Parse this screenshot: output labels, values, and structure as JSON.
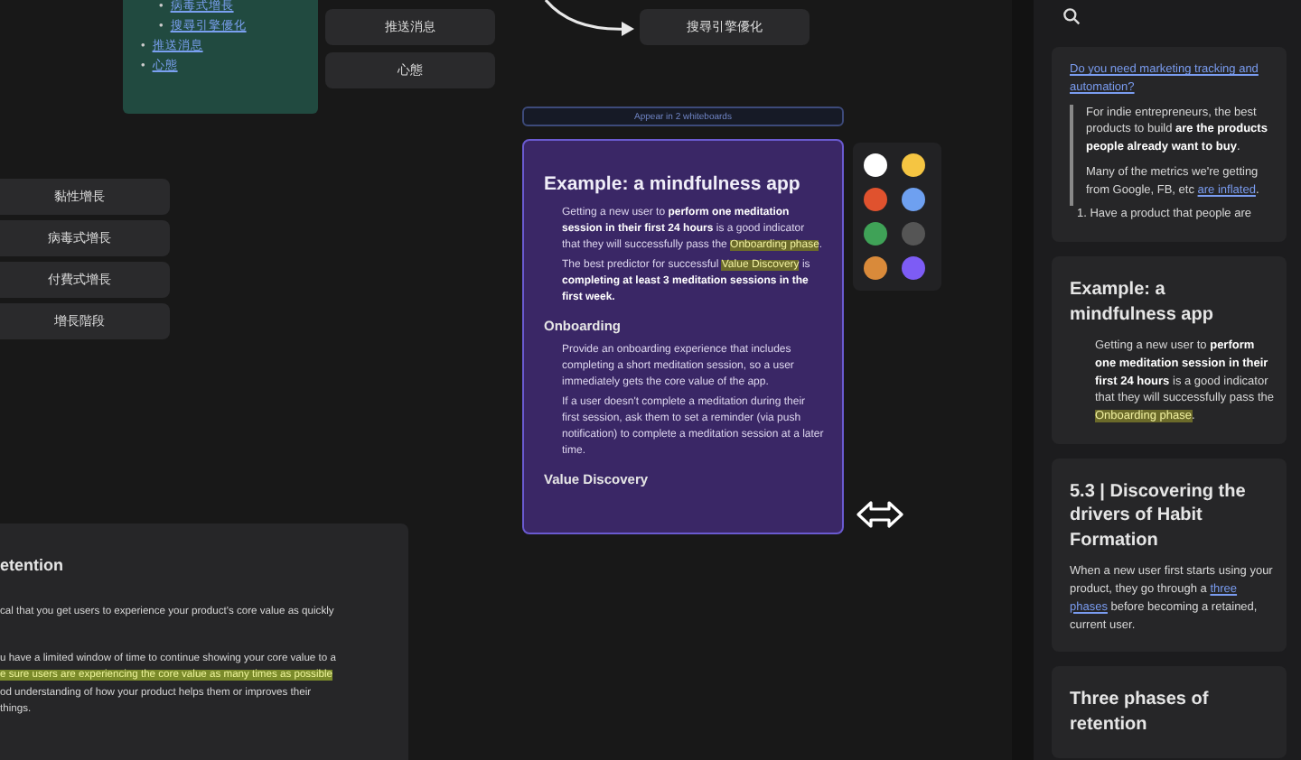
{
  "outline_card": {
    "items": [
      {
        "marker": "•",
        "text": "病毒式增長"
      },
      {
        "marker": "•",
        "text": "搜尋引擎優化"
      }
    ],
    "top_items": [
      {
        "marker": "•",
        "text": "推送消息"
      },
      {
        "marker": "•",
        "text": "心態"
      }
    ]
  },
  "topic_cards": [
    {
      "text": "推送消息"
    },
    {
      "text": "心態"
    }
  ],
  "linked_card": {
    "text": "搜尋引擎優化"
  },
  "left_cards": [
    {
      "text": "黏性增長"
    },
    {
      "text": "病毒式增長"
    },
    {
      "text": "付費式增長"
    },
    {
      "text": "增長階段"
    }
  ],
  "appear_bar": {
    "text": "Appear in 2 whiteboards"
  },
  "main_card": {
    "title": "Example: a mindfulness app",
    "blocks": [
      {
        "kind": "bullet",
        "parts": [
          {
            "kind": "plain",
            "text": "Getting a new user to "
          },
          {
            "kind": "bold",
            "text": "perform one meditation session in their first 24 hours"
          },
          {
            "kind": "plain",
            "text": " is a good indicator that they will successfully pass the "
          },
          {
            "kind": "highlight",
            "text": "Onboarding phase"
          },
          {
            "kind": "plain",
            "text": "."
          }
        ]
      },
      {
        "kind": "bullet",
        "parts": [
          {
            "kind": "plain",
            "text": "The best predictor for successful "
          },
          {
            "kind": "highlight",
            "text": "Value Discovery"
          },
          {
            "kind": "plain",
            "text": " is "
          },
          {
            "kind": "bold",
            "text": "completing at least 3 meditation sessions in the first week."
          }
        ]
      },
      {
        "kind": "heading",
        "parts": [
          {
            "kind": "plain",
            "text": "Onboarding"
          }
        ]
      },
      {
        "kind": "bullet",
        "parts": [
          {
            "kind": "plain",
            "text": "Provide an onboarding experience that includes completing a short meditation session, so a user immediately gets the core value of the app."
          }
        ]
      },
      {
        "kind": "bullet",
        "parts": [
          {
            "kind": "plain",
            "text": "If a user doesn't complete a meditation during their first session, ask them to set a reminder (via push notification) to complete a meditation session at a later time."
          }
        ]
      },
      {
        "kind": "heading",
        "parts": [
          {
            "kind": "plain",
            "text": "Value Discovery"
          }
        ]
      }
    ]
  },
  "palette": [
    {
      "color": "#ffffff"
    },
    {
      "color": "#f5c542"
    },
    {
      "color": "#e0522e"
    },
    {
      "color": "#6ea0f0"
    },
    {
      "color": "#3fa257"
    },
    {
      "color": "#555555"
    },
    {
      "color": "#d98a3a"
    },
    {
      "color": "#7d5cf5"
    }
  ],
  "retention_card": {
    "title": "etention",
    "lines": [
      {
        "kind": "plain",
        "text": "cal that you get users to experience your product's core value as quickly"
      },
      {
        "kind": "gap"
      },
      {
        "kind": "plain",
        "text": "u have a limited window of time to continue showing your core value to a"
      },
      {
        "kind": "highlight",
        "text": "e sure users are experiencing the core value as many times as possible"
      },
      {
        "kind": "plain",
        "text": "od understanding of how your product helps them or improves their"
      },
      {
        "kind": "plain",
        "text": "things."
      }
    ]
  },
  "sidebar": {
    "cards": [
      {
        "blocks": [
          {
            "kind": "para",
            "parts": [
              {
                "kind": "link",
                "text": "Do you need marketing tracking and automation?"
              }
            ]
          },
          {
            "kind": "quote",
            "parts": [
              {
                "kind": "plain",
                "text": "For indie entrepreneurs, the best products to build "
              },
              {
                "kind": "bold",
                "text": "are the products people already want to buy"
              },
              {
                "kind": "plain",
                "text": "."
              }
            ]
          },
          {
            "kind": "quote",
            "parts": [
              {
                "kind": "plain",
                "text": "Many of the metrics we're getting from Google, FB, etc "
              },
              {
                "kind": "link",
                "text": "are inflated"
              },
              {
                "kind": "plain",
                "text": "."
              }
            ]
          },
          {
            "kind": "numbered",
            "parts": [
              {
                "kind": "plain",
                "text": "1.  Have a product that people are"
              }
            ]
          }
        ]
      },
      {
        "title": "Example: a mindfulness app",
        "blocks": [
          {
            "kind": "bullet",
            "parts": [
              {
                "kind": "plain",
                "text": "Getting a new user to "
              },
              {
                "kind": "bold",
                "text": "perform one meditation session in their first 24 hours"
              },
              {
                "kind": "plain",
                "text": " is a good indicator that they will successfully pass the "
              },
              {
                "kind": "highlight",
                "text": "Onboarding phase"
              },
              {
                "kind": "plain",
                "text": "."
              }
            ]
          }
        ]
      },
      {
        "title": "5.3 | Discovering the drivers of Habit Formation",
        "blocks": [
          {
            "kind": "para",
            "parts": [
              {
                "kind": "plain",
                "text": "When a new user first starts using your product, they go through a "
              },
              {
                "kind": "link",
                "text": "three phases"
              },
              {
                "kind": "plain",
                "text": " before becoming a retained, current user."
              }
            ]
          }
        ]
      },
      {
        "title": "Three phases of retention"
      }
    ]
  }
}
